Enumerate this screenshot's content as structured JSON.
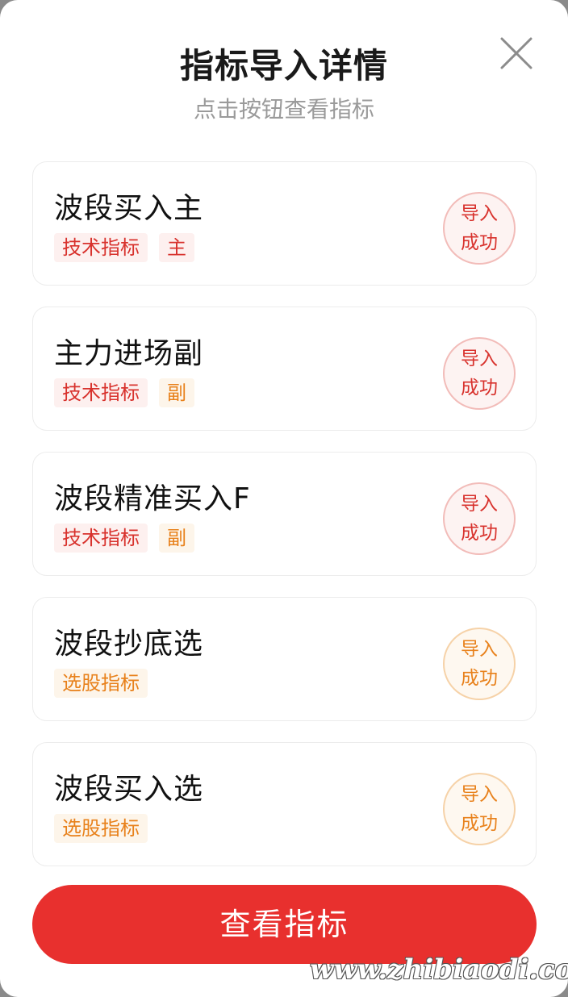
{
  "header": {
    "title": "指标导入详情",
    "subtitle": "点击按钮查看指标"
  },
  "items": [
    {
      "name": "波段买入主",
      "tags": [
        {
          "label": "技术指标",
          "color": "red"
        },
        {
          "label": "主",
          "color": "red"
        }
      ],
      "status_line1": "导入",
      "status_line2": "成功",
      "status_color": "red"
    },
    {
      "name": "主力进场副",
      "tags": [
        {
          "label": "技术指标",
          "color": "red"
        },
        {
          "label": "副",
          "color": "orange"
        }
      ],
      "status_line1": "导入",
      "status_line2": "成功",
      "status_color": "red"
    },
    {
      "name": "波段精准买入F",
      "tags": [
        {
          "label": "技术指标",
          "color": "red"
        },
        {
          "label": "副",
          "color": "orange"
        }
      ],
      "status_line1": "导入",
      "status_line2": "成功",
      "status_color": "red"
    },
    {
      "name": "波段抄底选",
      "tags": [
        {
          "label": "选股指标",
          "color": "orange"
        }
      ],
      "status_line1": "导入",
      "status_line2": "成功",
      "status_color": "orange"
    },
    {
      "name": "波段买入选",
      "tags": [
        {
          "label": "选股指标",
          "color": "orange"
        }
      ],
      "status_line1": "导入",
      "status_line2": "成功",
      "status_color": "orange"
    }
  ],
  "button": {
    "label": "查看指标"
  },
  "watermark": "www.zhibiaodi.com",
  "colors": {
    "accent_red": "#e8302e",
    "tag_red": "#d8322d",
    "tag_orange": "#e8811b"
  },
  "icons": {
    "close": "close-icon"
  }
}
